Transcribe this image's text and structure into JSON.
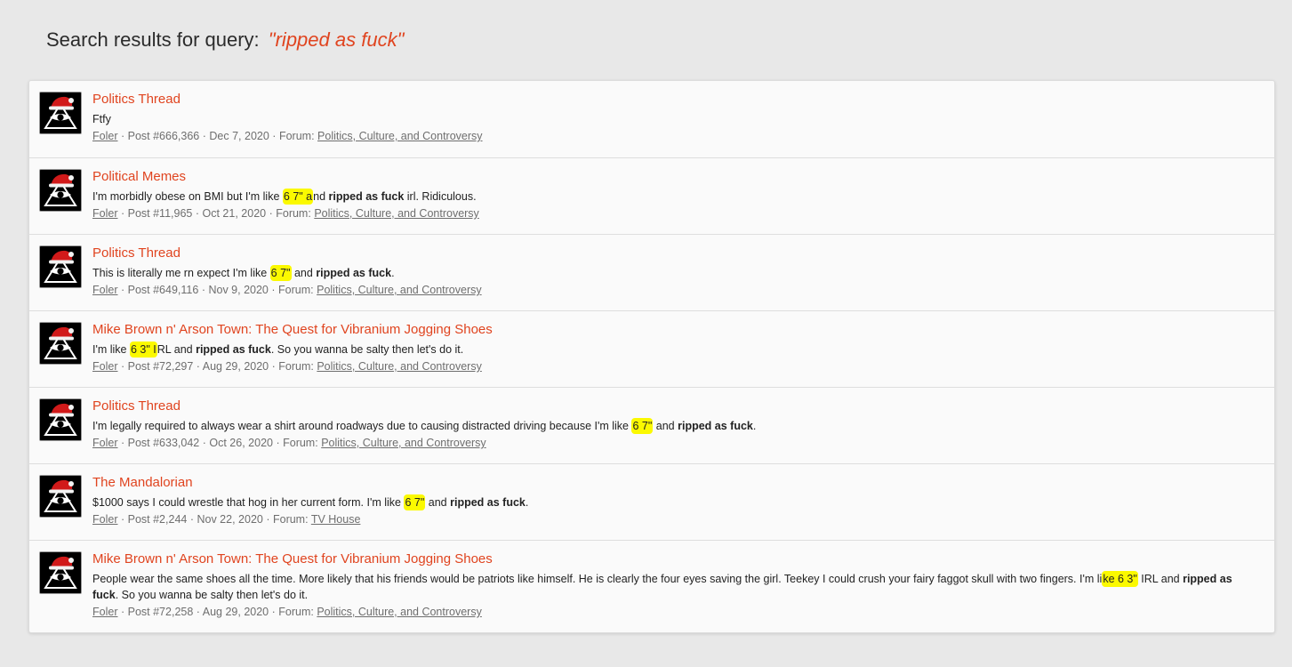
{
  "header": {
    "prefix": "Search results for query:",
    "query": "\"ripped as fuck\""
  },
  "separator": "·",
  "results": [
    {
      "title": "Politics Thread",
      "snippet": [
        {
          "t": "Ftfy"
        }
      ],
      "author": "Foler",
      "post": "Post #666,366",
      "date": "Dec 7, 2020",
      "forum_label": "Forum:",
      "forum": "Politics, Culture, and Controversy"
    },
    {
      "title": "Political Memes",
      "snippet": [
        {
          "t": "I'm morbidly obese on BMI but I'm like "
        },
        {
          "t": "6 7\" a",
          "hl": true
        },
        {
          "t": "nd "
        },
        {
          "t": "ripped as fuck",
          "b": true
        },
        {
          "t": " irl. Ridiculous."
        }
      ],
      "author": "Foler",
      "post": "Post #11,965",
      "date": "Oct 21, 2020",
      "forum_label": "Forum:",
      "forum": "Politics, Culture, and Controversy"
    },
    {
      "title": "Politics Thread",
      "snippet": [
        {
          "t": "This is literally me rn expect I'm like "
        },
        {
          "t": "6 7\"",
          "hl": true
        },
        {
          "t": " and "
        },
        {
          "t": "ripped as fuck",
          "b": true
        },
        {
          "t": "."
        }
      ],
      "author": "Foler",
      "post": "Post #649,116",
      "date": "Nov 9, 2020",
      "forum_label": "Forum:",
      "forum": "Politics, Culture, and Controversy"
    },
    {
      "title": "Mike Brown n' Arson Town: The Quest for Vibranium Jogging Shoes",
      "snippet": [
        {
          "t": "I'm like "
        },
        {
          "t": "6 3\" I",
          "hl": true
        },
        {
          "t": "RL and "
        },
        {
          "t": "ripped as fuck",
          "b": true
        },
        {
          "t": ". So you wanna be salty then let's do it."
        }
      ],
      "author": "Foler",
      "post": "Post #72,297",
      "date": "Aug 29, 2020",
      "forum_label": "Forum:",
      "forum": "Politics, Culture, and Controversy"
    },
    {
      "title": "Politics Thread",
      "snippet": [
        {
          "t": "I'm legally required to always wear a shirt around roadways due to causing distracted driving because I'm like "
        },
        {
          "t": "6 7\"",
          "hl": true
        },
        {
          "t": " and "
        },
        {
          "t": "ripped as fuck",
          "b": true
        },
        {
          "t": "."
        }
      ],
      "author": "Foler",
      "post": "Post #633,042",
      "date": "Oct 26, 2020",
      "forum_label": "Forum:",
      "forum": "Politics, Culture, and Controversy"
    },
    {
      "title": "The Mandalorian",
      "snippet": [
        {
          "t": "$1000 says I could wrestle that hog in her current form. I'm like "
        },
        {
          "t": "6 7\"",
          "hl": true
        },
        {
          "t": " and "
        },
        {
          "t": "ripped as fuck",
          "b": true
        },
        {
          "t": "."
        }
      ],
      "author": "Foler",
      "post": "Post #2,244",
      "date": "Nov 22, 2020",
      "forum_label": "Forum:",
      "forum": "TV House"
    },
    {
      "title": "Mike Brown n' Arson Town: The Quest for Vibranium Jogging Shoes",
      "tall": true,
      "snippet": [
        {
          "t": "People wear the same shoes all the time. More likely that his friends would be patriots like himself. He is clearly the four eyes saving the girl. Teekey I could crush your fairy faggot skull with two fingers. I'm li"
        },
        {
          "t": "ke 6 3\"",
          "hl": true
        },
        {
          "t": " IRL and "
        },
        {
          "t": "ripped as fuck",
          "b": true
        },
        {
          "t": ". So you wanna be salty then let's do it."
        }
      ],
      "author": "Foler",
      "post": "Post #72,258",
      "date": "Aug 29, 2020",
      "forum_label": "Forum:",
      "forum": "Politics, Culture, and Controversy"
    }
  ],
  "avatar_icon": "santa-hat-illuminati-eye-icon",
  "colors": {
    "accent": "#e0441f",
    "highlight": "#fbf900",
    "background": "#e8e8e8",
    "panel": "#fafafa"
  }
}
